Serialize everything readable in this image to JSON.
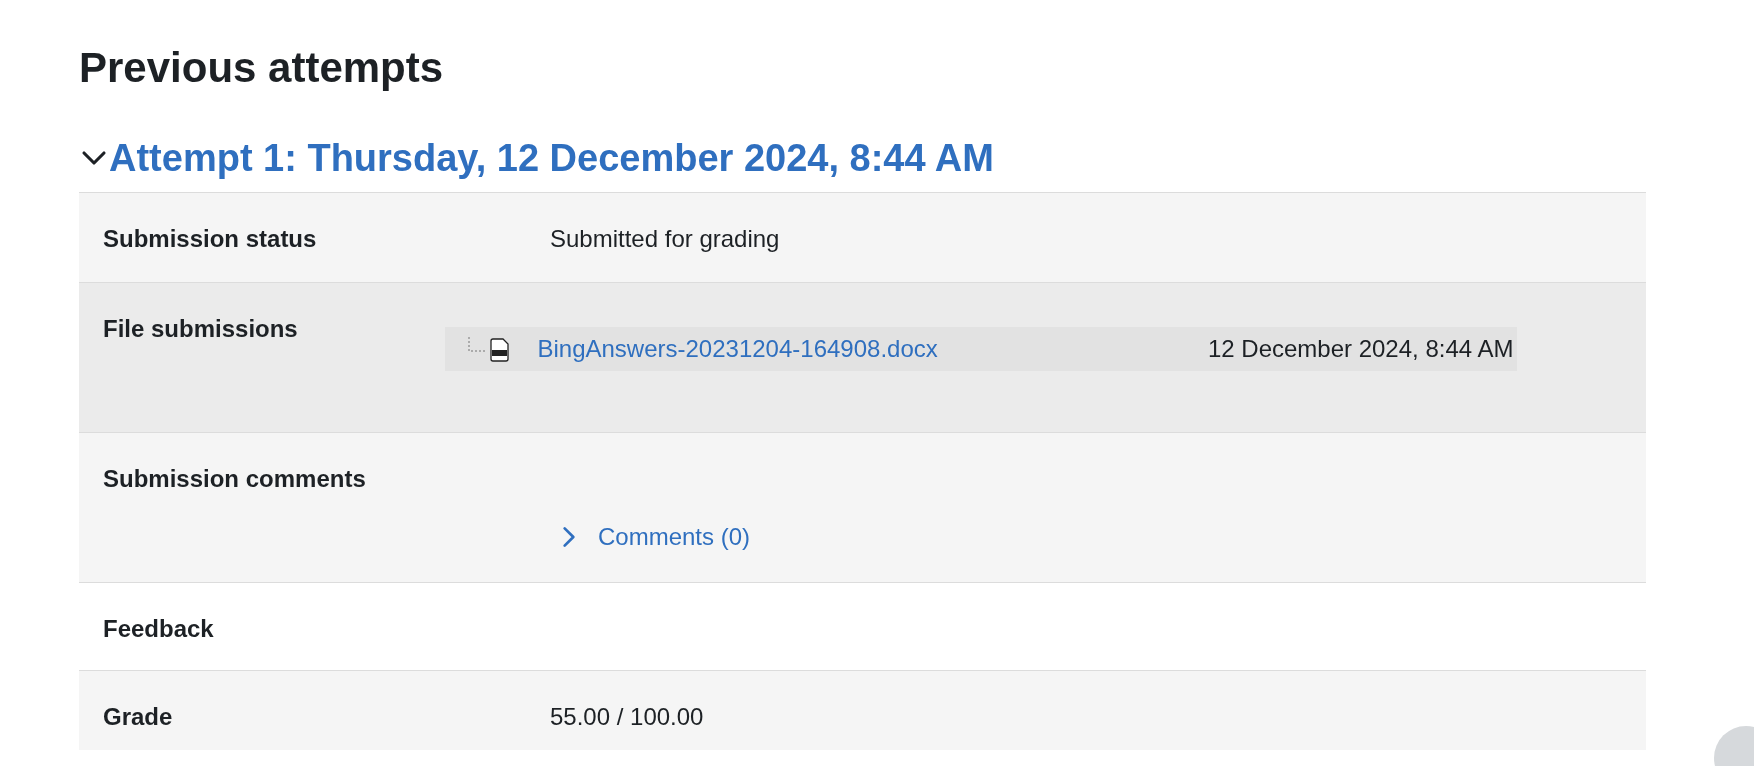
{
  "page_title": "Previous attempts",
  "attempt": {
    "title": "Attempt 1: Thursday, 12 December 2024, 8:44 AM",
    "expanded": true
  },
  "rows": [
    {
      "kind": "text",
      "label": "Submission status",
      "value": "Submitted for grading"
    },
    {
      "kind": "files",
      "label": "File submissions",
      "files": [
        {
          "name": "BingAnswers-20231204-164908.docx",
          "date": "12 December 2024, 8:44 AM"
        }
      ]
    },
    {
      "kind": "comments",
      "label": "Submission comments",
      "link": "Comments (0)",
      "expanded": false
    },
    {
      "kind": "text",
      "label": "Feedback"
    },
    {
      "kind": "text",
      "label": "Grade",
      "value": "55.00 / 100.00"
    }
  ]
}
